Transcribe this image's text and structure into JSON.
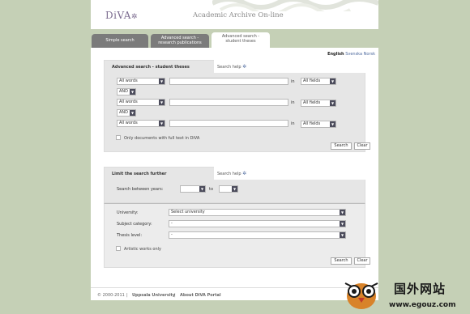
{
  "header": {
    "logo": "DiVA",
    "title": "Academic Archive On-line"
  },
  "tabs": [
    {
      "line1": "Simple search",
      "line2": ""
    },
    {
      "line1": "Advanced search -",
      "line2": "research publications"
    },
    {
      "line1": "Advanced search -",
      "line2": "student theses"
    }
  ],
  "languages": {
    "active": "English",
    "other1": "Svenska",
    "other2": "Norsk"
  },
  "advanced": {
    "title": "Advanced search - student theses",
    "help": "Search help",
    "rows": [
      {
        "type": "All words",
        "in": "in",
        "field": "All fields"
      },
      {
        "type": "All words",
        "in": "in",
        "field": "All fields"
      },
      {
        "type": "All words",
        "in": "in",
        "field": "All fields"
      }
    ],
    "operators": [
      "AND",
      "AND"
    ],
    "fulltext_label": "Only documents with full text in DiVA",
    "search_btn": "Search",
    "clear_btn": "Clear"
  },
  "limit": {
    "title": "Limit the search further",
    "help": "Search help",
    "years_label": "Search between years:",
    "to_label": "to",
    "university_label": "University:",
    "university_value": "Select university",
    "subject_label": "Subject category:",
    "subject_value": "-",
    "level_label": "Thesis level:",
    "level_value": "-",
    "artistic_label": "Artistic works only",
    "search_btn": "Search",
    "clear_btn": "Clear"
  },
  "footer": {
    "copyright": "© 2000-2011",
    "sep1": "|",
    "university": "Uppsala University",
    "sep2": "|",
    "about": "About DiVA Portal"
  },
  "watermark": {
    "cn": "国外网站",
    "url": "www.egouz.com"
  },
  "colors": {
    "background": "#c5d0b6",
    "tab_inactive": "#7b7b7b",
    "logo": "#7b6b8f",
    "link": "#4e6a9e"
  }
}
